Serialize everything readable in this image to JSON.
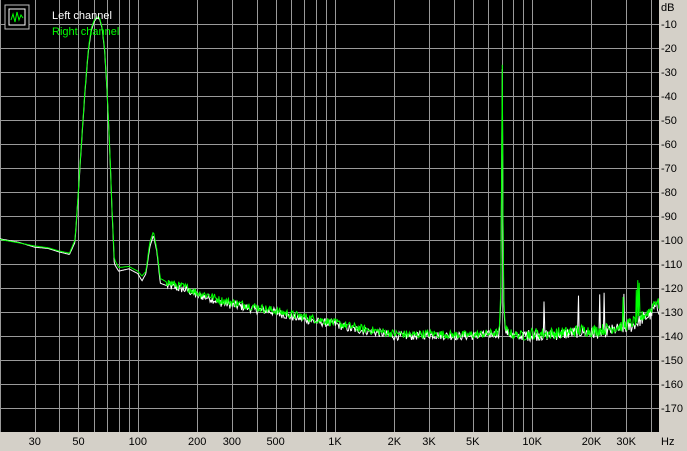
{
  "chart_data": {
    "type": "line",
    "xscale": "log",
    "xlim": [
      20,
      44000
    ],
    "ylim": [
      -180,
      0
    ],
    "grid": true,
    "legend_position": "top-left",
    "ylabel": "dB",
    "xlabel": "Hz",
    "y_ticks": [
      -10,
      -20,
      -30,
      -40,
      -50,
      -60,
      -70,
      -80,
      -90,
      -100,
      -110,
      -120,
      -130,
      -140,
      -150,
      -160,
      -170
    ],
    "x_ticks": [
      {
        "v": 30,
        "label": "30"
      },
      {
        "v": 50,
        "label": "50"
      },
      {
        "v": 100,
        "label": "100"
      },
      {
        "v": 200,
        "label": "200"
      },
      {
        "v": 300,
        "label": "300"
      },
      {
        "v": 500,
        "label": "500"
      },
      {
        "v": 1000,
        "label": "1K"
      },
      {
        "v": 2000,
        "label": "2K"
      },
      {
        "v": 3000,
        "label": "3K"
      },
      {
        "v": 5000,
        "label": "5K"
      },
      {
        "v": 10000,
        "label": "10K"
      },
      {
        "v": 20000,
        "label": "20K"
      },
      {
        "v": 30000,
        "label": "30K"
      }
    ],
    "series": [
      {
        "name": "Left channel",
        "color": "#ffffff",
        "points": [
          [
            20,
            -99.5
          ],
          [
            25,
            -101
          ],
          [
            30,
            -103
          ],
          [
            35,
            -103.5
          ],
          [
            40,
            -105
          ],
          [
            45,
            -106
          ],
          [
            48,
            -101
          ],
          [
            50,
            -80
          ],
          [
            52,
            -58
          ],
          [
            54,
            -38
          ],
          [
            56,
            -22
          ],
          [
            58,
            -13
          ],
          [
            60,
            -9
          ],
          [
            62,
            -7.5
          ],
          [
            64,
            -8
          ],
          [
            66,
            -12
          ],
          [
            68,
            -22
          ],
          [
            70,
            -40
          ],
          [
            72,
            -62
          ],
          [
            74,
            -88
          ],
          [
            76,
            -110
          ],
          [
            80,
            -113
          ],
          [
            90,
            -112
          ],
          [
            100,
            -114
          ],
          [
            105,
            -117
          ],
          [
            110,
            -114
          ],
          [
            115,
            -103
          ],
          [
            120,
            -98
          ],
          [
            125,
            -105
          ],
          [
            130,
            -118
          ],
          [
            140,
            -119
          ],
          [
            160,
            -120
          ],
          [
            180,
            -121
          ],
          [
            200,
            -123
          ],
          [
            230,
            -124
          ],
          [
            260,
            -126
          ],
          [
            300,
            -127
          ],
          [
            350,
            -128
          ],
          [
            400,
            -129
          ],
          [
            500,
            -130
          ],
          [
            600,
            -132
          ],
          [
            700,
            -133
          ],
          [
            800,
            -134
          ],
          [
            1000,
            -135
          ],
          [
            1200,
            -137
          ],
          [
            1500,
            -138
          ],
          [
            2000,
            -140
          ],
          [
            2500,
            -140
          ],
          [
            3000,
            -139.5
          ],
          [
            4000,
            -140
          ],
          [
            5000,
            -140
          ],
          [
            6000,
            -139.5
          ],
          [
            6800,
            -139
          ],
          [
            6950,
            -125
          ],
          [
            7050,
            -20
          ],
          [
            7150,
            -125
          ],
          [
            7300,
            -138
          ],
          [
            8000,
            -140
          ],
          [
            9000,
            -140
          ],
          [
            10000,
            -139.5
          ],
          [
            12000,
            -139.5
          ],
          [
            15000,
            -139
          ],
          [
            18000,
            -138
          ],
          [
            20000,
            -139
          ],
          [
            24000,
            -138
          ],
          [
            28000,
            -137
          ],
          [
            32000,
            -136
          ],
          [
            36000,
            -133
          ],
          [
            40000,
            -131
          ],
          [
            42000,
            -128
          ],
          [
            44000,
            -129
          ]
        ]
      },
      {
        "name": "Right channel",
        "color": "#00ff00",
        "points": [
          [
            20,
            -99.8
          ],
          [
            25,
            -101.2
          ],
          [
            30,
            -102.5
          ],
          [
            35,
            -103.2
          ],
          [
            40,
            -104.6
          ],
          [
            45,
            -105.5
          ],
          [
            48,
            -100
          ],
          [
            50,
            -79
          ],
          [
            52,
            -57
          ],
          [
            54,
            -37
          ],
          [
            56,
            -21
          ],
          [
            58,
            -12
          ],
          [
            60,
            -8.5
          ],
          [
            62,
            -7
          ],
          [
            64,
            -7.5
          ],
          [
            66,
            -11.5
          ],
          [
            68,
            -21
          ],
          [
            70,
            -39
          ],
          [
            72,
            -61
          ],
          [
            74,
            -87
          ],
          [
            76,
            -108
          ],
          [
            80,
            -111.5
          ],
          [
            90,
            -111
          ],
          [
            100,
            -113
          ],
          [
            105,
            -115
          ],
          [
            110,
            -113
          ],
          [
            115,
            -101
          ],
          [
            120,
            -96.5
          ],
          [
            125,
            -104
          ],
          [
            130,
            -116
          ],
          [
            140,
            -117.5
          ],
          [
            160,
            -119
          ],
          [
            180,
            -120
          ],
          [
            200,
            -122
          ],
          [
            230,
            -123
          ],
          [
            260,
            -125
          ],
          [
            300,
            -126
          ],
          [
            350,
            -127
          ],
          [
            400,
            -128
          ],
          [
            500,
            -129.5
          ],
          [
            600,
            -131
          ],
          [
            700,
            -132
          ],
          [
            800,
            -133
          ],
          [
            1000,
            -134.5
          ],
          [
            1200,
            -136
          ],
          [
            1500,
            -137.5
          ],
          [
            2000,
            -139
          ],
          [
            2500,
            -139.5
          ],
          [
            3000,
            -139
          ],
          [
            4000,
            -139.5
          ],
          [
            5000,
            -139.5
          ],
          [
            6000,
            -139
          ],
          [
            6800,
            -138.5
          ],
          [
            6950,
            -120
          ],
          [
            7050,
            -18.5
          ],
          [
            7150,
            -120
          ],
          [
            7300,
            -137
          ],
          [
            8000,
            -139.5
          ],
          [
            9000,
            -139.5
          ],
          [
            10000,
            -139
          ],
          [
            12000,
            -139
          ],
          [
            15000,
            -138.5
          ],
          [
            18000,
            -137.5
          ],
          [
            20000,
            -138
          ],
          [
            24000,
            -137
          ],
          [
            28000,
            -136
          ],
          [
            32000,
            -134.5
          ],
          [
            36000,
            -132
          ],
          [
            40000,
            -129
          ],
          [
            42000,
            -125
          ],
          [
            44000,
            -127
          ]
        ]
      }
    ]
  }
}
